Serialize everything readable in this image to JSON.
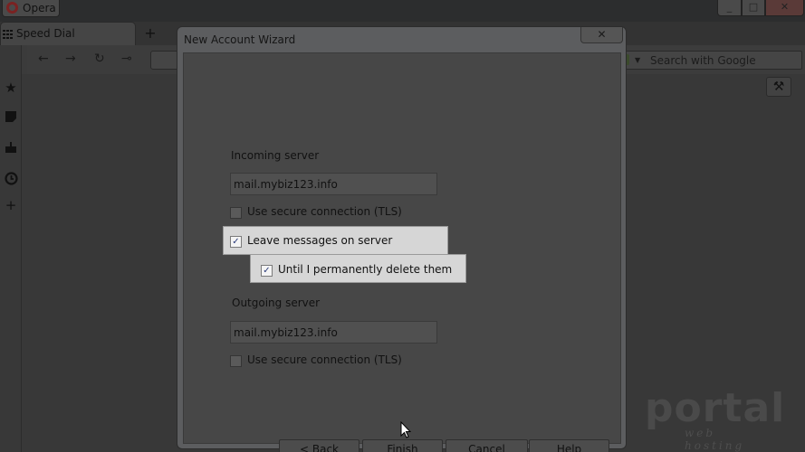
{
  "browser": {
    "menu_label": "Opera",
    "tab_label": "Speed Dial",
    "new_tab_symbol": "+",
    "search_placeholder": "Search with Google",
    "window_controls": {
      "minimize": "_",
      "maximize": "□",
      "close": "✕"
    }
  },
  "sidebar": {
    "icons": [
      "bookmarks-icon",
      "notes-icon",
      "downloads-icon",
      "history-icon",
      "add-panel-icon"
    ]
  },
  "dialog": {
    "title": "New Account Wizard",
    "close_symbol": "✕",
    "incoming": {
      "label": "Incoming server",
      "server_value": "mail.mybiz123.info",
      "tls_label": "Use secure connection (TLS)",
      "tls_checked": false,
      "leave_label": "Leave messages on server",
      "leave_checked": true,
      "until_label": "Until I permanently delete them",
      "until_checked": true
    },
    "outgoing": {
      "label": "Outgoing server",
      "server_value": "mail.mybiz123.info",
      "tls_label": "Use secure connection (TLS)",
      "tls_checked": false
    },
    "buttons": {
      "back": "< Back",
      "finish": "Finish",
      "cancel": "Cancel",
      "help": "Help"
    }
  },
  "watermark": {
    "main": "portal",
    "sub": "web hosting"
  }
}
